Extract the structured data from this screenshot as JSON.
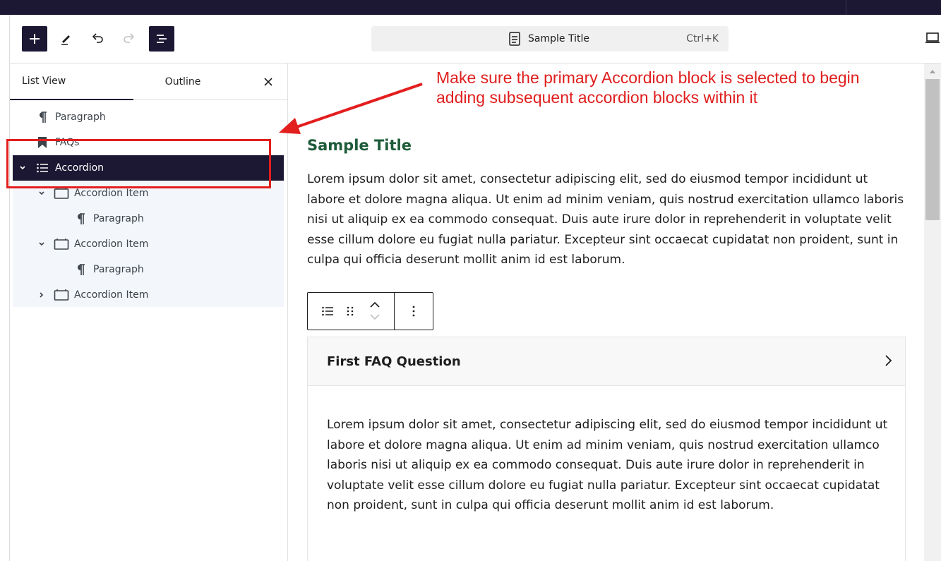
{
  "toolbar": {
    "add_label": "Add block",
    "command_bar": {
      "title": "Sample Title",
      "shortcut": "Ctrl+K"
    }
  },
  "sidebar": {
    "tabs": [
      {
        "label": "List View",
        "active": true
      },
      {
        "label": "Outline",
        "active": false
      }
    ],
    "items": [
      {
        "label": "Paragraph",
        "icon": "paragraph-icon",
        "level": 1,
        "expandable": false
      },
      {
        "label": "FAQs",
        "icon": "bookmark-icon",
        "level": 1,
        "expandable": false
      },
      {
        "label": "Accordion",
        "icon": "list-icon",
        "level": 1,
        "expandable": true,
        "expanded": true,
        "selected": true
      },
      {
        "label": "Accordion Item",
        "icon": "accordion-item-icon",
        "level": 2,
        "expandable": true,
        "expanded": true
      },
      {
        "label": "Paragraph",
        "icon": "paragraph-icon",
        "level": 3,
        "expandable": false
      },
      {
        "label": "Accordion Item",
        "icon": "accordion-item-icon",
        "level": 2,
        "expandable": true,
        "expanded": true
      },
      {
        "label": "Paragraph",
        "icon": "paragraph-icon",
        "level": 3,
        "expandable": false
      },
      {
        "label": "Accordion Item",
        "icon": "accordion-item-icon",
        "level": 2,
        "expandable": true,
        "expanded": false
      }
    ]
  },
  "content": {
    "title": "Sample Title",
    "paragraph": "Lorem ipsum dolor sit amet, consectetur adipiscing elit, sed do eiusmod tempor incididunt ut labore et dolore magna aliqua. Ut enim ad minim veniam, quis nostrud exercitation ullamco laboris nisi ut aliquip ex ea commodo consequat. Duis aute irure dolor in reprehenderit in voluptate velit esse cillum dolore eu fugiat nulla pariatur. Excepteur sint occaecat cupidatat non proident, sunt in culpa qui officia deserunt mollit anim id est laborum.",
    "accordion": {
      "question": "First FAQ Question",
      "answer": "Lorem ipsum dolor sit amet, consectetur adipiscing elit, sed do eiusmod tempor incididunt ut labore et dolore magna aliqua. Ut enim ad minim veniam, quis nostrud exercitation ullamco laboris nisi ut aliquip ex ea commodo consequat. Duis aute irure dolor in reprehenderit in voluptate velit esse cillum dolore eu fugiat nulla pariatur. Excepteur sint occaecat cupidatat non proident, sunt in culpa qui officia deserunt mollit anim id est laborum."
    }
  },
  "annotation": {
    "line1": "Make sure the primary Accordion block is selected to begin",
    "line2": "adding subsequent accordion blocks within it",
    "color": "#e01e1e"
  },
  "colors": {
    "dark": "#1c1833",
    "title_green": "#1e5c3a",
    "annotation_red": "#e31e1e"
  }
}
